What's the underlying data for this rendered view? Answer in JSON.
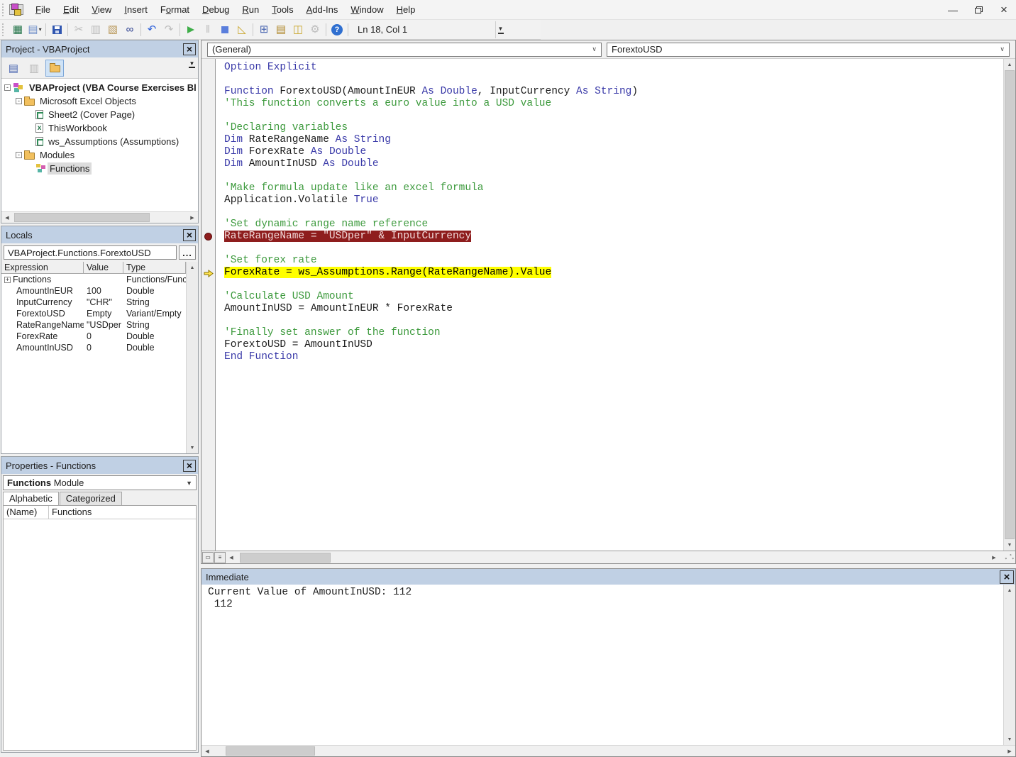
{
  "window": {
    "title_hidden": true,
    "controls": [
      {
        "name": "minimize"
      },
      {
        "name": "restore"
      },
      {
        "name": "close"
      }
    ]
  },
  "menu": {
    "items": [
      {
        "label": "File",
        "u": 0
      },
      {
        "label": "Edit",
        "u": 0
      },
      {
        "label": "View",
        "u": 0
      },
      {
        "label": "Insert",
        "u": 0
      },
      {
        "label": "Format",
        "u": 1
      },
      {
        "label": "Debug",
        "u": 0
      },
      {
        "label": "Run",
        "u": 0
      },
      {
        "label": "Tools",
        "u": 0
      },
      {
        "label": "Add-Ins",
        "u": 0
      },
      {
        "label": "Window",
        "u": 0
      },
      {
        "label": "Help",
        "u": 0
      }
    ]
  },
  "toolbar": {
    "status": "Ln 18, Col 1",
    "buttons": [
      {
        "name": "view-microsoft-excel",
        "glyph": "▦",
        "color": "#1e7145",
        "enabled": true
      },
      {
        "name": "insert-userform",
        "glyph": "▤",
        "color": "#6f8fc9",
        "enabled": true,
        "dropdown": true
      },
      {
        "name": "save",
        "icon": "save",
        "enabled": true,
        "sep_before": true
      },
      {
        "name": "cut",
        "glyph": "✂",
        "enabled": false,
        "sep_before": true
      },
      {
        "name": "copy",
        "glyph": "▥",
        "enabled": false
      },
      {
        "name": "paste",
        "glyph": "▧",
        "color": "#b9985a",
        "enabled": true
      },
      {
        "name": "find",
        "glyph": "∞",
        "color": "#2b3f8f",
        "enabled": true
      },
      {
        "name": "undo",
        "glyph": "↶",
        "color": "#2b5fd9",
        "enabled": true,
        "sep_before": true
      },
      {
        "name": "redo",
        "glyph": "↷",
        "enabled": false
      },
      {
        "name": "run",
        "icon": "run",
        "enabled": true,
        "sep_before": true
      },
      {
        "name": "break",
        "glyph": "‖",
        "enabled": false
      },
      {
        "name": "reset",
        "icon": "reset",
        "enabled": true
      },
      {
        "name": "design-mode",
        "glyph": "◺",
        "color": "#caa72e",
        "enabled": true
      },
      {
        "name": "project-explorer",
        "glyph": "⊞",
        "color": "#4a66b0",
        "enabled": true,
        "sep_before": true
      },
      {
        "name": "properties-window",
        "glyph": "▤",
        "color": "#b0882a",
        "enabled": true
      },
      {
        "name": "object-browser",
        "glyph": "◫",
        "color": "#caa72e",
        "enabled": true
      },
      {
        "name": "toolbox",
        "glyph": "⚙",
        "enabled": false
      },
      {
        "name": "help",
        "icon": "help",
        "enabled": true,
        "sep_before": true
      }
    ]
  },
  "project": {
    "title": "Project - VBAProject",
    "tree": [
      {
        "label": "VBAProject (VBA Course Exercises Bl",
        "icon": "vba-project",
        "expander": "-",
        "level": 0,
        "bold": true
      },
      {
        "label": "Microsoft Excel Objects",
        "icon": "folder",
        "expander": "-",
        "level": 1
      },
      {
        "label": "Sheet2 (Cover Page)",
        "icon": "excel-sheet",
        "level": 2
      },
      {
        "label": "ThisWorkbook",
        "icon": "excel-workbook",
        "level": 2
      },
      {
        "label": "ws_Assumptions (Assumptions)",
        "icon": "excel-sheet",
        "level": 2
      },
      {
        "label": "Modules",
        "icon": "folder",
        "expander": "-",
        "level": 1
      },
      {
        "label": "Functions",
        "icon": "module",
        "level": 2,
        "selected": true
      }
    ]
  },
  "locals": {
    "title": "Locals",
    "context": "VBAProject.Functions.ForextoUSD",
    "more_button": "...",
    "columns": [
      "Expression",
      "Value",
      "Type"
    ],
    "rows": [
      {
        "expander": "+",
        "expression": "Functions",
        "value": "",
        "type": "Functions/Funct"
      },
      {
        "expression": "AmountInEUR",
        "value": "100",
        "type": "Double"
      },
      {
        "expression": "InputCurrency",
        "value": "\"CHR\"",
        "type": "String"
      },
      {
        "expression": "ForextoUSD",
        "value": "Empty",
        "type": "Variant/Empty"
      },
      {
        "expression": "RateRangeName",
        "value": "\"USDper",
        "type": "String"
      },
      {
        "expression": "ForexRate",
        "value": "0",
        "type": "Double"
      },
      {
        "expression": "AmountInUSD",
        "value": "0",
        "type": "Double"
      }
    ]
  },
  "properties": {
    "title": "Properties - Functions",
    "selector_bold": "Functions",
    "selector_rest": " Module",
    "tabs": [
      "Alphabetic",
      "Categorized"
    ],
    "active_tab": "Alphabetic",
    "rows": [
      {
        "name": "(Name)",
        "value": "Functions"
      }
    ]
  },
  "code": {
    "left_dropdown": "(General)",
    "right_dropdown": "ForextoUSD",
    "lines": [
      {
        "segments": [
          {
            "t": "Option Explicit",
            "c": "kw"
          }
        ]
      },
      {
        "segments": []
      },
      {
        "segments": [
          {
            "t": "Function",
            "c": "kw"
          },
          {
            "t": " ForextoUSD(AmountInEUR ",
            "c": "tx"
          },
          {
            "t": "As",
            "c": "kw"
          },
          {
            "t": " ",
            "c": "tx"
          },
          {
            "t": "Double",
            "c": "kw"
          },
          {
            "t": ", InputCurrency ",
            "c": "tx"
          },
          {
            "t": "As",
            "c": "kw"
          },
          {
            "t": " ",
            "c": "tx"
          },
          {
            "t": "String",
            "c": "kw"
          },
          {
            "t": ")",
            "c": "tx"
          }
        ]
      },
      {
        "segments": [
          {
            "t": "'This function converts a euro value into a USD value",
            "c": "cm"
          }
        ]
      },
      {
        "segments": []
      },
      {
        "segments": [
          {
            "t": "'Declaring variables",
            "c": "cm"
          }
        ]
      },
      {
        "segments": [
          {
            "t": "Dim",
            "c": "kw"
          },
          {
            "t": " RateRangeName ",
            "c": "tx"
          },
          {
            "t": "As",
            "c": "kw"
          },
          {
            "t": " ",
            "c": "tx"
          },
          {
            "t": "String",
            "c": "kw"
          }
        ]
      },
      {
        "segments": [
          {
            "t": "Dim",
            "c": "kw"
          },
          {
            "t": " ForexRate ",
            "c": "tx"
          },
          {
            "t": "As",
            "c": "kw"
          },
          {
            "t": " ",
            "c": "tx"
          },
          {
            "t": "Double",
            "c": "kw"
          }
        ]
      },
      {
        "segments": [
          {
            "t": "Dim",
            "c": "kw"
          },
          {
            "t": " AmountInUSD ",
            "c": "tx"
          },
          {
            "t": "As",
            "c": "kw"
          },
          {
            "t": " ",
            "c": "tx"
          },
          {
            "t": "Double",
            "c": "kw"
          }
        ]
      },
      {
        "segments": []
      },
      {
        "segments": [
          {
            "t": "'Make formula update like an excel formula",
            "c": "cm"
          }
        ]
      },
      {
        "segments": [
          {
            "t": "Application.Volatile ",
            "c": "tx"
          },
          {
            "t": "True",
            "c": "kw"
          }
        ]
      },
      {
        "segments": []
      },
      {
        "segments": [
          {
            "t": "'Set dynamic range name reference",
            "c": "cm"
          }
        ]
      },
      {
        "hl": "bp",
        "marker": "breakpoint",
        "segments": [
          {
            "t": "RateRangeName = \"USDper\" & InputCurrency",
            "c": "bp"
          }
        ]
      },
      {
        "segments": []
      },
      {
        "segments": [
          {
            "t": "'Set forex rate",
            "c": "cm"
          }
        ]
      },
      {
        "hl": "cur",
        "marker": "current",
        "segments": [
          {
            "t": "ForexRate = ws_Assumptions.Range(RateRangeName).Value",
            "c": "cur"
          }
        ]
      },
      {
        "segments": []
      },
      {
        "segments": [
          {
            "t": "'Calculate USD Amount",
            "c": "cm"
          }
        ]
      },
      {
        "segments": [
          {
            "t": "AmountInUSD = AmountInEUR * ForexRate",
            "c": "tx"
          }
        ]
      },
      {
        "segments": []
      },
      {
        "segments": [
          {
            "t": "'Finally set answer of the function",
            "c": "cm"
          }
        ]
      },
      {
        "segments": [
          {
            "t": "ForextoUSD = AmountInUSD",
            "c": "tx"
          }
        ]
      },
      {
        "segments": [
          {
            "t": "End Function",
            "c": "kw"
          }
        ]
      }
    ]
  },
  "immediate": {
    "title": "Immediate",
    "lines": [
      "Current Value of AmountInUSD: 112",
      " 112"
    ]
  },
  "colors": {
    "keyword": "#3939a8",
    "comment": "#3d9a3d",
    "text": "#1c1c1c",
    "breakpoint_bg": "#8e1d1d",
    "breakpoint_fg": "#f2dada",
    "current_bg": "#ffff00",
    "current_fg": "#000000",
    "panel_header_bg": "#c0d0e4"
  }
}
